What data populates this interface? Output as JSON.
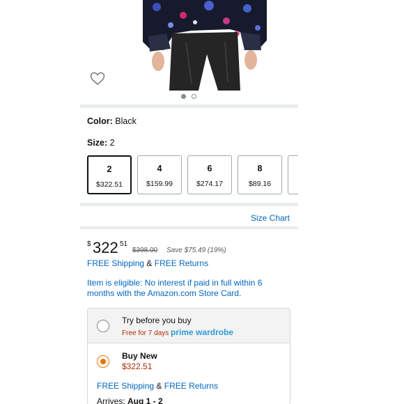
{
  "product": {
    "favorite_icon": "heart-outline-icon",
    "image_dots": {
      "count": 2,
      "active_index": 0
    }
  },
  "color": {
    "label": "Color:",
    "value": "Black"
  },
  "size": {
    "label": "Size:",
    "value": "2",
    "options": [
      {
        "size": "2",
        "price": "$322.51",
        "selected": true
      },
      {
        "size": "4",
        "price": "$159.99",
        "selected": false
      },
      {
        "size": "6",
        "price": "$274.17",
        "selected": false
      },
      {
        "size": "8",
        "price": "$89.16",
        "selected": false
      },
      {
        "size": "",
        "price": "",
        "selected": false
      }
    ]
  },
  "size_chart_link": "Size Chart",
  "price": {
    "currency_symbol": "$",
    "whole": "322",
    "fraction": "51",
    "list_price": "$398.00",
    "savings": "Save $75.49 (19%)"
  },
  "shipping": {
    "free_shipping": "FREE Shipping",
    "ampersand": "&",
    "free_returns": "FREE Returns"
  },
  "eligibility": "Item is eligible: No interest if paid in full within 6 months with the Amazon.com Store Card.",
  "purchase_options": {
    "try": {
      "title": "Try before you buy",
      "subtitle": "Free for 7 days",
      "brand": "prime wardrobe",
      "selected": false
    },
    "buy": {
      "title": "Buy New",
      "price": "$322.51",
      "selected": true,
      "free_shipping": "FREE Shipping",
      "ampersand": "&",
      "free_returns": "FREE Returns",
      "arrives_label": "Arrives:",
      "arrives_date": "Aug 1 - 2"
    }
  },
  "colors": {
    "link": "#0066c0",
    "price_red": "#b12704",
    "radio_orange": "#e77600",
    "prime_blue": "#2e9bd6",
    "divider": "#eaeded"
  }
}
